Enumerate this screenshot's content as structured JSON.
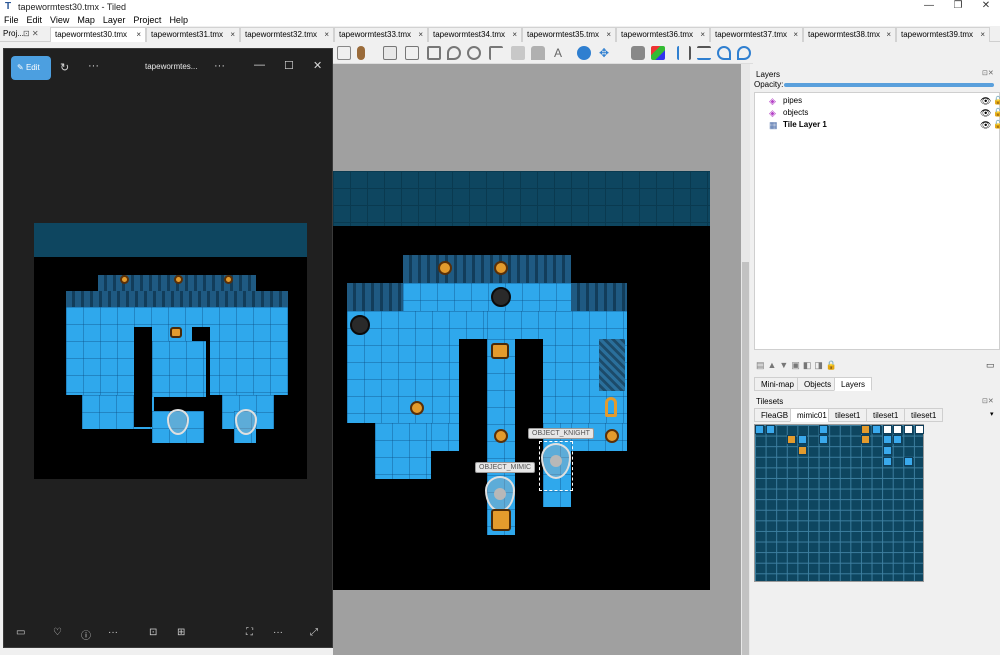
{
  "window": {
    "title": "tapewormtest30.tmx - Tiled",
    "app_icon": "tiled-logo-icon",
    "controls": [
      "—",
      "❐",
      "✕"
    ]
  },
  "menu": {
    "items": [
      "File",
      "Edit",
      "View",
      "Map",
      "Layer",
      "Project",
      "Help"
    ]
  },
  "tabs": {
    "project_label": "Proj...",
    "items": [
      {
        "label": "tapewormtest30.tmx",
        "active": true
      },
      {
        "label": "tapewormtest31.tmx",
        "active": false
      },
      {
        "label": "tapewormtest32.tmx",
        "active": false
      },
      {
        "label": "tapewormtest33.tmx",
        "active": false
      },
      {
        "label": "tapewormtest34.tmx",
        "active": false
      },
      {
        "label": "tapewormtest35.tmx",
        "active": false
      },
      {
        "label": "tapewormtest36.tmx",
        "active": false
      },
      {
        "label": "tapewormtest37.tmx",
        "active": false
      },
      {
        "label": "tapewormtest38.tmx",
        "active": false
      },
      {
        "label": "tapewormtest39.tmx",
        "active": false
      }
    ],
    "close_glyph": "×"
  },
  "map_objects": {
    "mimic_label": "OBJECT_MIMIC",
    "knight_label": "OBJECT_KNIGHT"
  },
  "layers_panel": {
    "title": "Layers",
    "opacity_label": "Opacity:",
    "layers": [
      {
        "name": "pipes",
        "icon": "object-layer-icon",
        "visible": true,
        "locked": false
      },
      {
        "name": "objects",
        "icon": "object-layer-icon",
        "visible": true,
        "locked": false
      },
      {
        "name": "Tile Layer 1",
        "icon": "tile-layer-icon",
        "visible": true,
        "locked": false
      }
    ]
  },
  "dock_tabs": {
    "items": [
      {
        "label": "Mini-map",
        "active": false
      },
      {
        "label": "Objects",
        "active": false
      },
      {
        "label": "Layers",
        "active": true
      }
    ]
  },
  "tilesets_panel": {
    "title": "Tilesets",
    "tabs": [
      {
        "label": "FleaGB",
        "active": false
      },
      {
        "label": "mimic01",
        "active": true
      },
      {
        "label": "tileset1",
        "active": false
      },
      {
        "label": "tileset1",
        "active": false
      },
      {
        "label": "tileset1",
        "active": false
      }
    ]
  },
  "photo_viewer": {
    "edit_label": "Edit",
    "filename": "tapewormtes...",
    "more": "···"
  },
  "colors": {
    "water_tile": "#2fa8ec",
    "map_band": "#0e4660",
    "accent": "#4c9fe0",
    "coin": "#e39b2d"
  }
}
